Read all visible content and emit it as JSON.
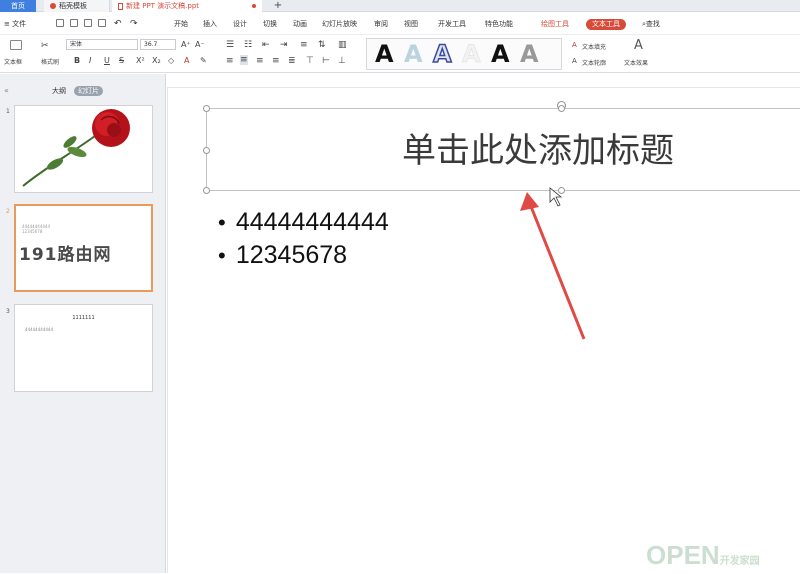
{
  "tabs": {
    "home": "首页",
    "template": "稻壳模板",
    "document": "新建 PPT 演示文稿.ppt",
    "add": "+"
  },
  "menu": {
    "file": "≡ 文件",
    "items": [
      "开始",
      "插入",
      "设计",
      "切换",
      "动画",
      "幻灯片放映",
      "审阅",
      "视图",
      "开发工具",
      "特色功能"
    ],
    "drawing_tools": "绘图工具",
    "text_tools": "文本工具",
    "search": "查找"
  },
  "toolbar": {
    "textbox": "文本框",
    "format_painter": "格式刷",
    "font_name": "宋体",
    "font_size": "36.7",
    "bold": "B",
    "italic": "I",
    "underline": "U",
    "strike": "S",
    "style_glyph": "A",
    "text_fill": "文本填充",
    "text_outline": "文本轮廓",
    "text_effect": "文本效果"
  },
  "left_panel": {
    "tab_outline": "大纲",
    "tab_slides": "幻灯片",
    "slides": [
      {
        "num": "1"
      },
      {
        "num": "2",
        "lines": [
          "44444444444",
          "12345678"
        ],
        "overlay": "191路由网"
      },
      {
        "num": "3",
        "title": "1111111",
        "line": "44444444444"
      }
    ]
  },
  "slide": {
    "title_placeholder": "单击此处添加标题",
    "bullets": [
      "44444444444",
      "12345678"
    ]
  },
  "watermark": {
    "text": "OPEN",
    "sub": "开发家园"
  },
  "colors": {
    "accent": "#d84a3a",
    "tab_home": "#3f7fe0",
    "arrow": "#e04a44"
  }
}
